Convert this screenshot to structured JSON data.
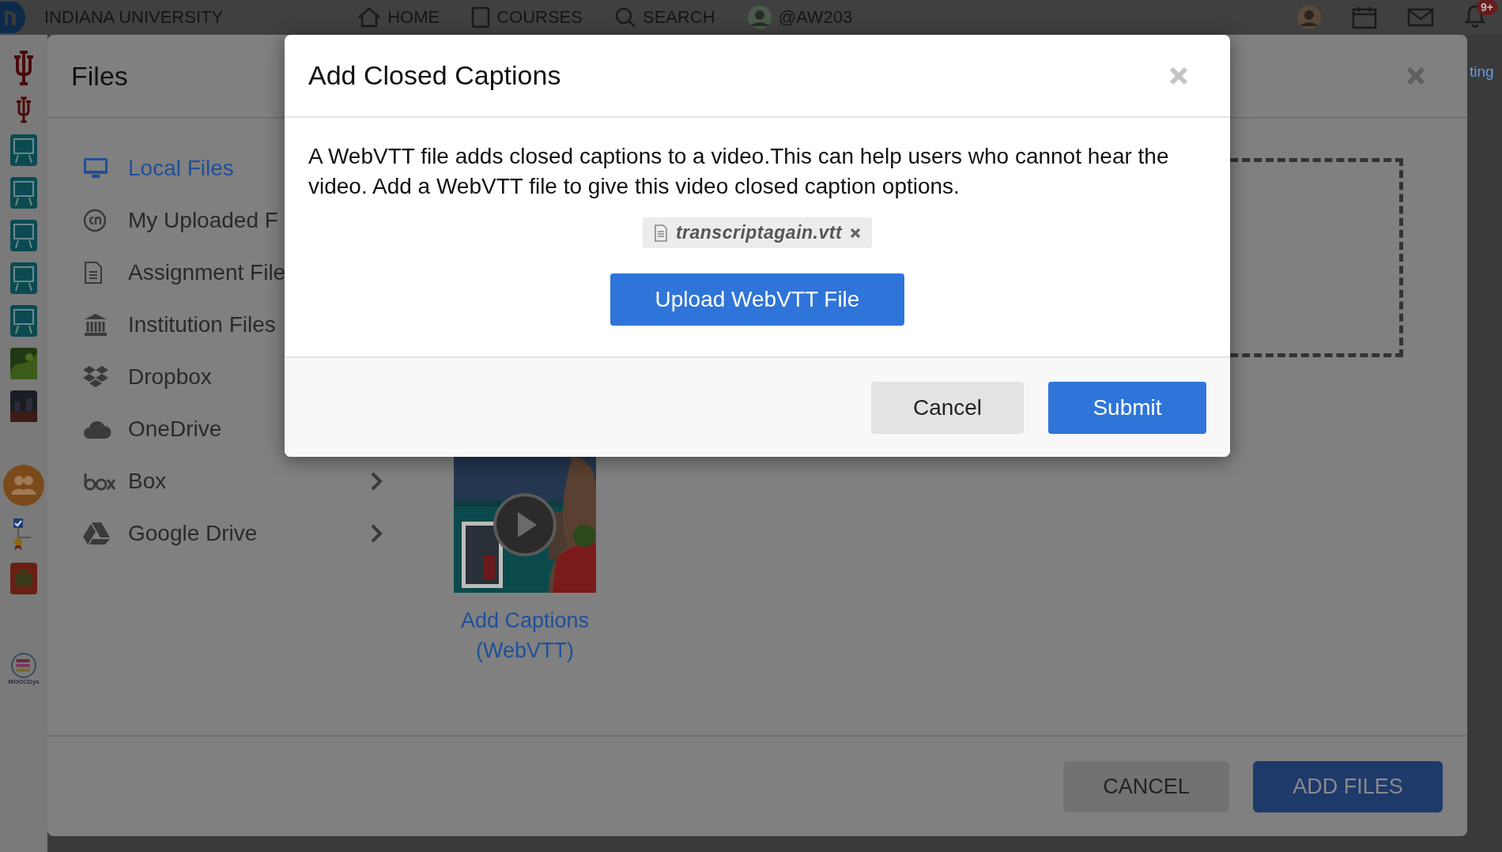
{
  "top_bar": {
    "brand": "INDIANA UNIVERSITY",
    "nav": [
      {
        "label": "HOME"
      },
      {
        "label": "COURSES"
      },
      {
        "label": "SEARCH"
      },
      {
        "label": "@AW203"
      }
    ],
    "notification_badge": "9+"
  },
  "side_rail": {
    "logo_caption": "MOOCDys"
  },
  "background_link": "ting",
  "files_dialog": {
    "title": "Files",
    "sources": [
      {
        "label": "Local Files",
        "selected": true
      },
      {
        "label": "My Uploaded F",
        "selected": false
      },
      {
        "label": "Assignment File",
        "selected": false
      },
      {
        "label": "Institution Files",
        "selected": false
      },
      {
        "label": "Dropbox",
        "selected": false
      },
      {
        "label": "OneDrive",
        "selected": false
      },
      {
        "label": "Box",
        "selected": false,
        "submenu": true
      },
      {
        "label": "Google Drive",
        "selected": false,
        "submenu": true
      }
    ],
    "items": [
      {
        "kind": "picture",
        "caption": "Add Captions (WebVTT)"
      }
    ],
    "buttons": [
      {
        "label": "CANCEL",
        "kind": "secondary"
      },
      {
        "label": "ADD FILES",
        "kind": "primary"
      }
    ]
  },
  "captions_dialog": {
    "title": "Add Closed Captions",
    "message": "A WebVTT file adds closed captions to a video.This can help users who cannot hear the video. Add a WebVTT file to give this video closed caption options.",
    "attached_file": "transcriptagain.vtt",
    "upload_button": "Upload WebVTT File",
    "buttons": [
      {
        "label": "Cancel",
        "kind": "secondary"
      },
      {
        "label": "Submit",
        "kind": "primary"
      }
    ]
  }
}
